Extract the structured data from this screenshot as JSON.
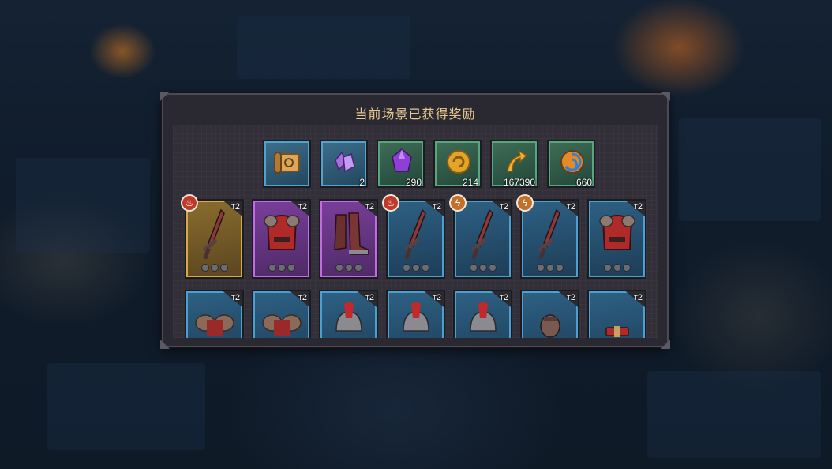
{
  "dialog": {
    "title": "当前场景已获得奖励"
  },
  "currencies": [
    {
      "icon": "scroll-icon",
      "quantity": "",
      "rarity": "blue"
    },
    {
      "icon": "purple-crystal-cluster-icon",
      "quantity": "2",
      "rarity": "blue"
    },
    {
      "icon": "purple-gem-icon",
      "quantity": "290",
      "rarity": "green"
    },
    {
      "icon": "gold-coin-icon",
      "quantity": "214",
      "rarity": "green"
    },
    {
      "icon": "exp-arrow-icon",
      "quantity": "167390",
      "rarity": "green"
    },
    {
      "icon": "orb-icon",
      "quantity": "660",
      "rarity": "green"
    }
  ],
  "equipment_row1": [
    {
      "item": "sword",
      "rarity": "gold",
      "tier": "2",
      "badge": "fire"
    },
    {
      "item": "chest-armor",
      "rarity": "purple",
      "tier": "2",
      "badge": ""
    },
    {
      "item": "boots",
      "rarity": "purple",
      "tier": "2",
      "badge": ""
    },
    {
      "item": "sword",
      "rarity": "blue",
      "tier": "2",
      "badge": "fire"
    },
    {
      "item": "sword",
      "rarity": "blue",
      "tier": "2",
      "badge": "lightning"
    },
    {
      "item": "sword",
      "rarity": "blue",
      "tier": "2",
      "badge": "lightning"
    },
    {
      "item": "chest-armor",
      "rarity": "blue",
      "tier": "2",
      "badge": ""
    }
  ],
  "equipment_row2": [
    {
      "item": "shoulder-armor",
      "rarity": "blue",
      "tier": "2"
    },
    {
      "item": "shoulder-armor",
      "rarity": "blue",
      "tier": "2"
    },
    {
      "item": "helmet",
      "rarity": "blue",
      "tier": "2"
    },
    {
      "item": "helmet",
      "rarity": "blue",
      "tier": "2"
    },
    {
      "item": "helmet",
      "rarity": "blue",
      "tier": "2"
    },
    {
      "item": "gloves",
      "rarity": "blue",
      "tier": "2"
    },
    {
      "item": "belt",
      "rarity": "blue",
      "tier": "2"
    }
  ],
  "tier_prefix": "T",
  "colors": {
    "title": "#e8c98f",
    "gold": "#d8aa44",
    "purple": "#c26ae8",
    "blue": "#4aa0d2",
    "green": "#57a67e"
  }
}
